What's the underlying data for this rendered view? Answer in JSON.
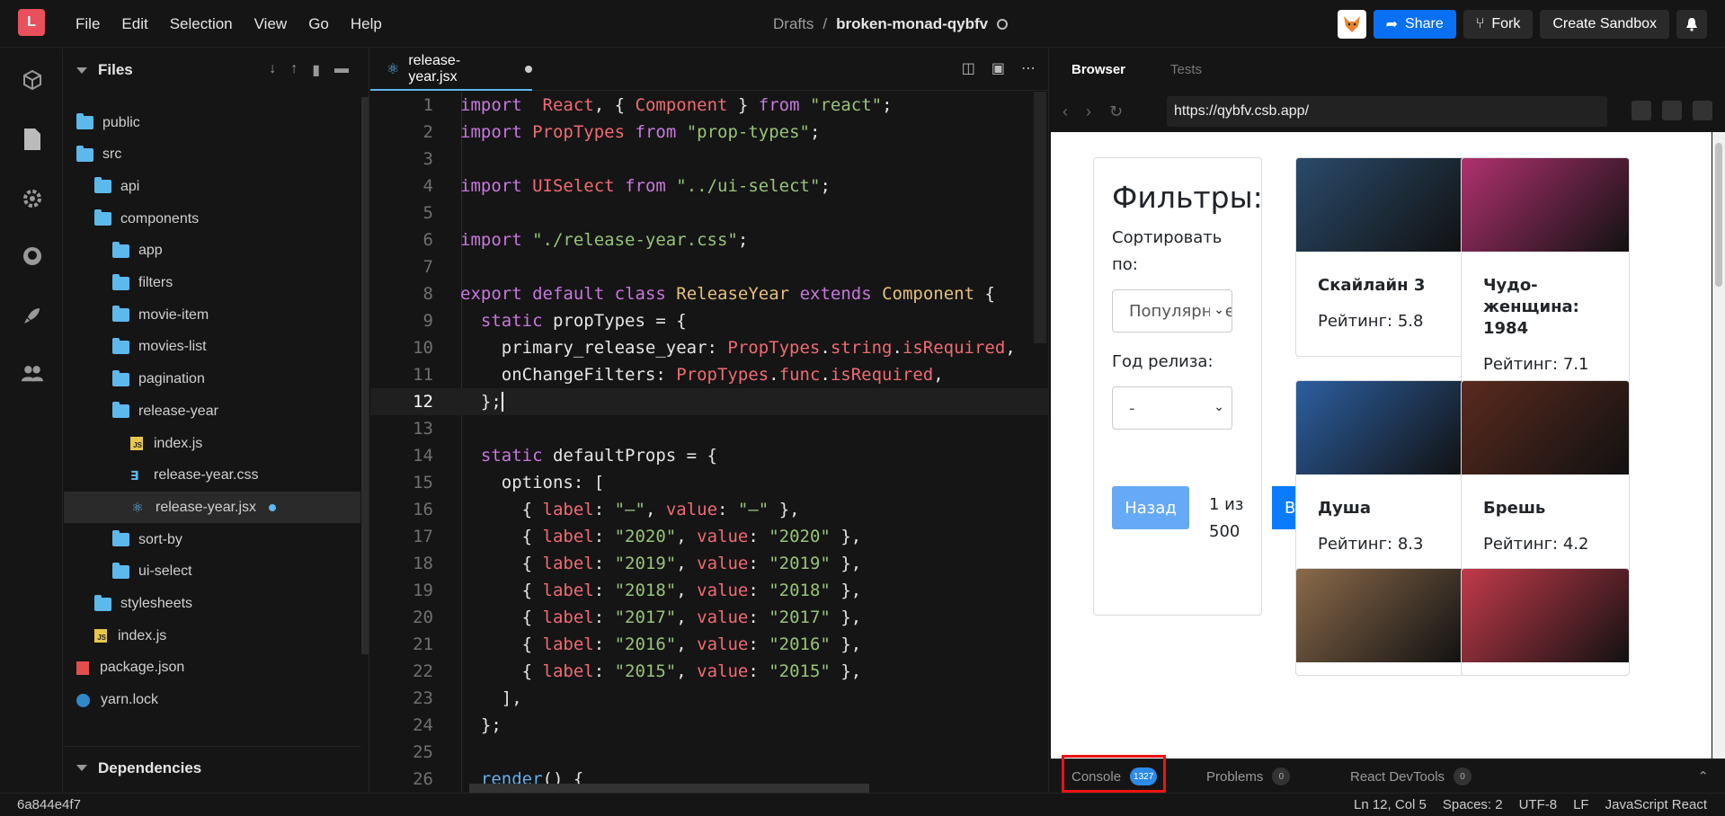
{
  "app": {
    "logo_letter": "L"
  },
  "menu": [
    "File",
    "Edit",
    "Selection",
    "View",
    "Go",
    "Help"
  ],
  "breadcrumb": {
    "parent": "Drafts",
    "separator": "/",
    "name": "broken-monad-qybfv"
  },
  "toolbar": {
    "share": "Share",
    "fork": "Fork",
    "create": "Create Sandbox"
  },
  "sidebar": {
    "title": "Files",
    "deps_title": "Dependencies",
    "tree": [
      {
        "label": "public",
        "type": "folder",
        "depth": 0
      },
      {
        "label": "src",
        "type": "folder",
        "depth": 0
      },
      {
        "label": "api",
        "type": "folder",
        "depth": 1
      },
      {
        "label": "components",
        "type": "folder",
        "depth": 1
      },
      {
        "label": "app",
        "type": "folder",
        "depth": 2
      },
      {
        "label": "filters",
        "type": "folder",
        "depth": 2
      },
      {
        "label": "movie-item",
        "type": "folder",
        "depth": 2
      },
      {
        "label": "movies-list",
        "type": "folder",
        "depth": 2
      },
      {
        "label": "pagination",
        "type": "folder",
        "depth": 2
      },
      {
        "label": "release-year",
        "type": "folder",
        "depth": 2
      },
      {
        "label": "index.js",
        "type": "js",
        "depth": 3
      },
      {
        "label": "release-year.css",
        "type": "css",
        "depth": 3
      },
      {
        "label": "release-year.jsx",
        "type": "react",
        "depth": 3,
        "active": true,
        "modified": true
      },
      {
        "label": "sort-by",
        "type": "folder",
        "depth": 2
      },
      {
        "label": "ui-select",
        "type": "folder",
        "depth": 2
      },
      {
        "label": "stylesheets",
        "type": "folder",
        "depth": 1
      },
      {
        "label": "index.js",
        "type": "js",
        "depth": 1
      },
      {
        "label": "package.json",
        "type": "pkg",
        "depth": 0
      },
      {
        "label": "yarn.lock",
        "type": "yarn",
        "depth": 0
      }
    ]
  },
  "editor": {
    "tab": "release-year.jsx",
    "current_line": 12,
    "lines": [
      [
        [
          "kw",
          "import"
        ],
        [
          "",
          "  "
        ],
        [
          "id",
          "React"
        ],
        [
          "",
          ", { "
        ],
        [
          "id",
          "Component"
        ],
        [
          "",
          " } "
        ],
        [
          "kw",
          "from"
        ],
        [
          "",
          " "
        ],
        [
          "str",
          "\"react\""
        ],
        [
          "",
          ";"
        ]
      ],
      [
        [
          "kw",
          "import"
        ],
        [
          "",
          " "
        ],
        [
          "id",
          "PropTypes"
        ],
        [
          "",
          " "
        ],
        [
          "kw",
          "from"
        ],
        [
          "",
          " "
        ],
        [
          "str",
          "\"prop-types\""
        ],
        [
          "",
          ";"
        ]
      ],
      [],
      [
        [
          "kw",
          "import"
        ],
        [
          "",
          " "
        ],
        [
          "id",
          "UISelect"
        ],
        [
          "",
          " "
        ],
        [
          "kw",
          "from"
        ],
        [
          "",
          " "
        ],
        [
          "str",
          "\"../ui-select\""
        ],
        [
          "",
          ";"
        ]
      ],
      [],
      [
        [
          "kw",
          "import"
        ],
        [
          "",
          " "
        ],
        [
          "str",
          "\"./release-year.css\""
        ],
        [
          "",
          ";"
        ]
      ],
      [],
      [
        [
          "kw",
          "export"
        ],
        [
          "",
          " "
        ],
        [
          "kw",
          "default"
        ],
        [
          "",
          " "
        ],
        [
          "kw",
          "class"
        ],
        [
          "",
          " "
        ],
        [
          "cls",
          "ReleaseYear"
        ],
        [
          "",
          " "
        ],
        [
          "kw",
          "extends"
        ],
        [
          "",
          " "
        ],
        [
          "cls",
          "Component"
        ],
        [
          "",
          " {"
        ]
      ],
      [
        [
          "",
          "  "
        ],
        [
          "kw",
          "static"
        ],
        [
          "",
          " propTypes = {"
        ]
      ],
      [
        [
          "",
          "    primary_release_year: "
        ],
        [
          "id",
          "PropTypes"
        ],
        [
          "",
          "."
        ],
        [
          "id",
          "string"
        ],
        [
          "",
          "."
        ],
        [
          "id",
          "isRequired"
        ],
        [
          "",
          ","
        ]
      ],
      [
        [
          "",
          "    onChangeFilters: "
        ],
        [
          "id",
          "PropTypes"
        ],
        [
          "",
          "."
        ],
        [
          "id",
          "func"
        ],
        [
          "",
          "."
        ],
        [
          "id",
          "isRequired"
        ],
        [
          "",
          ","
        ]
      ],
      [
        [
          "",
          "  };"
        ]
      ],
      [],
      [
        [
          "",
          "  "
        ],
        [
          "kw",
          "static"
        ],
        [
          "",
          " defaultProps = {"
        ]
      ],
      [
        [
          "",
          "    options: ["
        ]
      ],
      [
        [
          "",
          "      { "
        ],
        [
          "id",
          "label"
        ],
        [
          "",
          ": "
        ],
        [
          "str",
          "\"–\""
        ],
        [
          "",
          ", "
        ],
        [
          "id",
          "value"
        ],
        [
          "",
          ": "
        ],
        [
          "str",
          "\"–\""
        ],
        [
          "",
          " },"
        ]
      ],
      [
        [
          "",
          "      { "
        ],
        [
          "id",
          "label"
        ],
        [
          "",
          ": "
        ],
        [
          "str",
          "\"2020\""
        ],
        [
          "",
          ", "
        ],
        [
          "id",
          "value"
        ],
        [
          "",
          ": "
        ],
        [
          "str",
          "\"2020\""
        ],
        [
          "",
          " },"
        ]
      ],
      [
        [
          "",
          "      { "
        ],
        [
          "id",
          "label"
        ],
        [
          "",
          ": "
        ],
        [
          "str",
          "\"2019\""
        ],
        [
          "",
          ", "
        ],
        [
          "id",
          "value"
        ],
        [
          "",
          ": "
        ],
        [
          "str",
          "\"2019\""
        ],
        [
          "",
          " },"
        ]
      ],
      [
        [
          "",
          "      { "
        ],
        [
          "id",
          "label"
        ],
        [
          "",
          ": "
        ],
        [
          "str",
          "\"2018\""
        ],
        [
          "",
          ", "
        ],
        [
          "id",
          "value"
        ],
        [
          "",
          ": "
        ],
        [
          "str",
          "\"2018\""
        ],
        [
          "",
          " },"
        ]
      ],
      [
        [
          "",
          "      { "
        ],
        [
          "id",
          "label"
        ],
        [
          "",
          ": "
        ],
        [
          "str",
          "\"2017\""
        ],
        [
          "",
          ", "
        ],
        [
          "id",
          "value"
        ],
        [
          "",
          ": "
        ],
        [
          "str",
          "\"2017\""
        ],
        [
          "",
          " },"
        ]
      ],
      [
        [
          "",
          "      { "
        ],
        [
          "id",
          "label"
        ],
        [
          "",
          ": "
        ],
        [
          "str",
          "\"2016\""
        ],
        [
          "",
          ", "
        ],
        [
          "id",
          "value"
        ],
        [
          "",
          ": "
        ],
        [
          "str",
          "\"2016\""
        ],
        [
          "",
          " },"
        ]
      ],
      [
        [
          "",
          "      { "
        ],
        [
          "id",
          "label"
        ],
        [
          "",
          ": "
        ],
        [
          "str",
          "\"2015\""
        ],
        [
          "",
          ", "
        ],
        [
          "id",
          "value"
        ],
        [
          "",
          ": "
        ],
        [
          "str",
          "\"2015\""
        ],
        [
          "",
          " },"
        ]
      ],
      [
        [
          "",
          "    ],"
        ]
      ],
      [
        [
          "",
          "  };"
        ]
      ],
      [],
      [
        [
          "",
          "  "
        ],
        [
          "fn",
          "render"
        ],
        [
          "",
          "() {"
        ]
      ]
    ]
  },
  "preview": {
    "tabs": [
      "Browser",
      "Tests"
    ],
    "url": "https://qybfv.csb.app/",
    "filters": {
      "title": "Фильтры:",
      "sort_label": "Сортировать по:",
      "sort_value": "Популярные",
      "year_label": "Год релиза:",
      "year_value": "-",
      "back": "Назад",
      "page": "1 из 500",
      "next": "Вперёд"
    },
    "movies": [
      {
        "title": "Скайлайн 3",
        "rating": "Рейтинг: 5.8",
        "color": "#2a4a6b"
      },
      {
        "title": "Чудо-женщина: 1984",
        "rating": "Рейтинг: 7.1",
        "color": "#b0316f"
      },
      {
        "title": "Душа",
        "rating": "Рейтинг: 8.3",
        "color": "#2c5fa0"
      },
      {
        "title": "Брешь",
        "rating": "Рейтинг: 4.2",
        "color": "#5a2a1e"
      },
      {
        "title": "",
        "rating": "",
        "color": "#8a6a4a"
      },
      {
        "title": "",
        "rating": "",
        "color": "#c23a4a"
      }
    ],
    "bottom_tabs": [
      {
        "label": "Console",
        "count": "1327"
      },
      {
        "label": "Problems",
        "count": "0"
      },
      {
        "label": "React DevTools",
        "count": "0"
      }
    ]
  },
  "status": {
    "commit": "6a844e4f7",
    "position": "Ln 12, Col 5",
    "spaces": "Spaces: 2",
    "encoding": "UTF-8",
    "eol": "LF",
    "language": "JavaScript React"
  }
}
